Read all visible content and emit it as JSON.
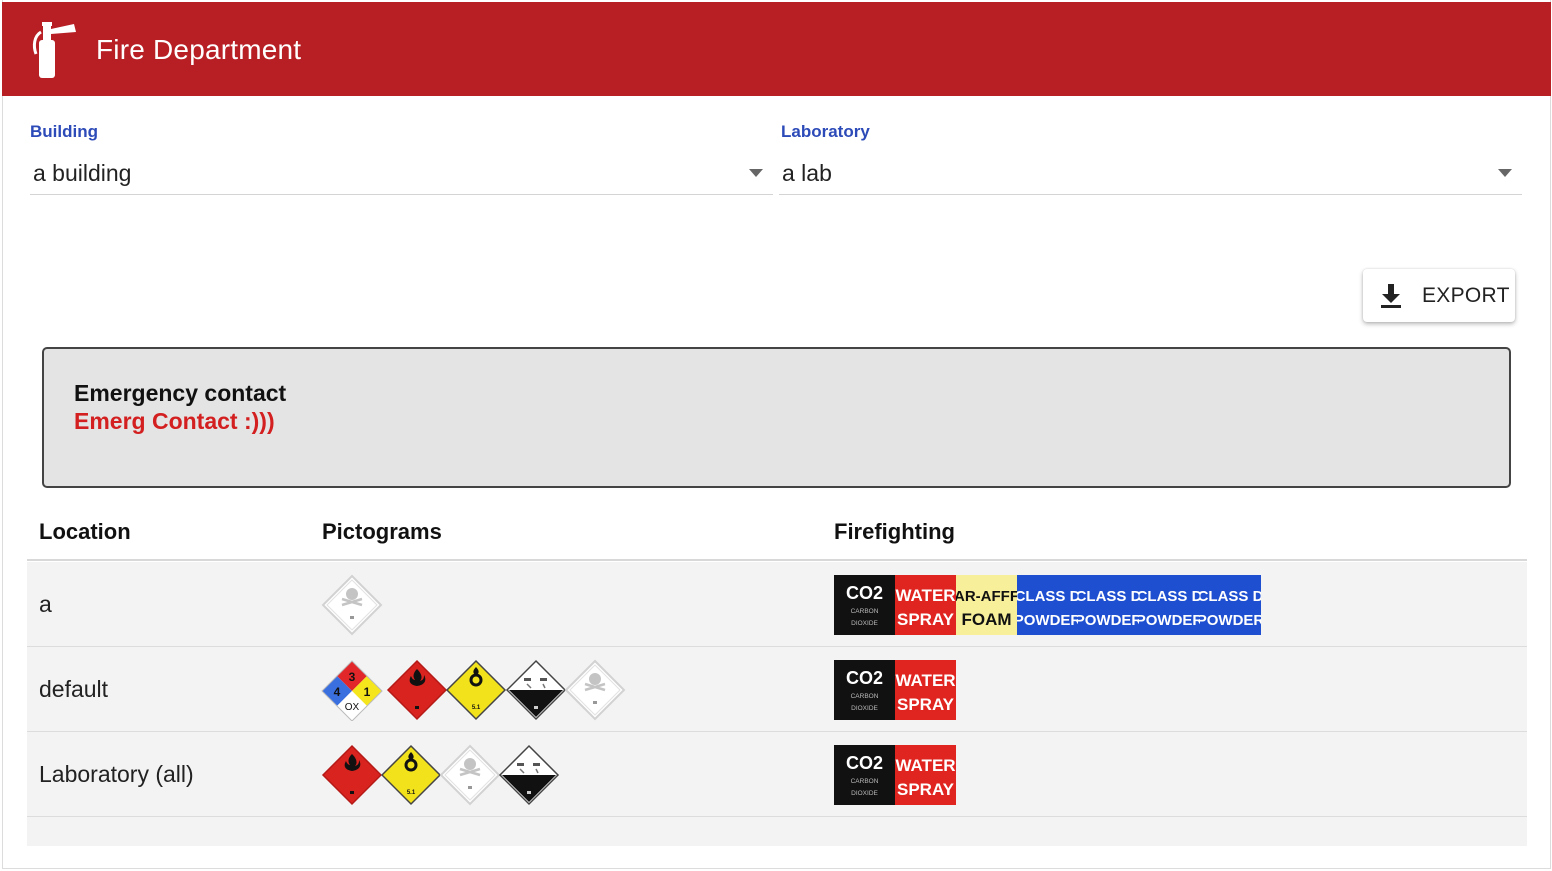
{
  "app": {
    "title": "Fire Department",
    "brand_color": "#b71f25",
    "logo_icon": "fire-extinguisher-icon"
  },
  "filters": {
    "building": {
      "label": "Building",
      "value": "a building"
    },
    "laboratory": {
      "label": "Laboratory",
      "value": "a lab"
    }
  },
  "export": {
    "label": "EXPORT",
    "icon": "download-icon"
  },
  "emergency": {
    "heading": "Emergency contact",
    "contact": "Emerg Contact :)))"
  },
  "table": {
    "headers": {
      "location": "Location",
      "pictograms": "Pictograms",
      "firefighting": "Firefighting"
    },
    "rows": [
      {
        "location": "a",
        "pictograms": [
          "toxic-skull"
        ],
        "firefighting": [
          "co2",
          "water-spray",
          "ar-afff-foam",
          "class-d-powder",
          "class-d-powder",
          "class-d-powder",
          "class-d-powder"
        ]
      },
      {
        "location": "default",
        "pictograms": [
          "nfpa-diamond",
          "flammable",
          "oxidizer",
          "corrosive",
          "toxic-skull"
        ],
        "nfpa": {
          "health": "4",
          "flammability": "3",
          "instability": "1",
          "special": "OX"
        },
        "firefighting": [
          "co2",
          "water-spray"
        ]
      },
      {
        "location": "Laboratory (all)",
        "pictograms": [
          "flammable",
          "oxidizer",
          "toxic-skull",
          "corrosive"
        ],
        "firefighting": [
          "co2",
          "water-spray"
        ]
      }
    ]
  },
  "labels": {
    "co2_main": "CO2",
    "co2_sub": "CARBON DIOXIDE",
    "water_1": "WATER",
    "water_2": "SPRAY",
    "foam_1": "AR-AFFF",
    "foam_2": "FOAM",
    "powder_1": "CLASS D",
    "powder_2": "POWDER",
    "oxidizer_class": "5.1"
  }
}
